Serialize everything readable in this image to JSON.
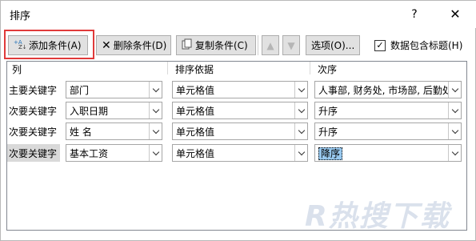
{
  "window": {
    "title": "排序",
    "help": "?",
    "close": "✕"
  },
  "toolbar": {
    "add_label": "添加条件(A)",
    "delete_label": "删除条件(D)",
    "copy_label": "复制条件(C)",
    "up_icon": "▲",
    "down_icon": "▼",
    "options_label": "选项(O)...",
    "header_checkbox_label": "数据包含标题(H)",
    "header_checkbox_checked": true
  },
  "grid": {
    "headers": [
      "列",
      "排序依据",
      "次序"
    ],
    "rows": [
      {
        "label": "主要关键字",
        "column": "部门",
        "sort_on": "单元格值",
        "order": "人事部, 财务处, 市场部, 后勤处"
      },
      {
        "label": "次要关键字",
        "column": "入职日期",
        "sort_on": "单元格值",
        "order": "升序"
      },
      {
        "label": "次要关键字",
        "column": "姓 名",
        "sort_on": "单元格值",
        "order": "升序"
      },
      {
        "label": "次要关键字",
        "column": "基本工资",
        "sort_on": "单元格值",
        "order": "降序"
      }
    ]
  },
  "watermark": "R热搜下载",
  "colors": {
    "highlight_border": "#e03a3a",
    "selection": "#99c9ef",
    "button_face": "#e1e1e1"
  }
}
